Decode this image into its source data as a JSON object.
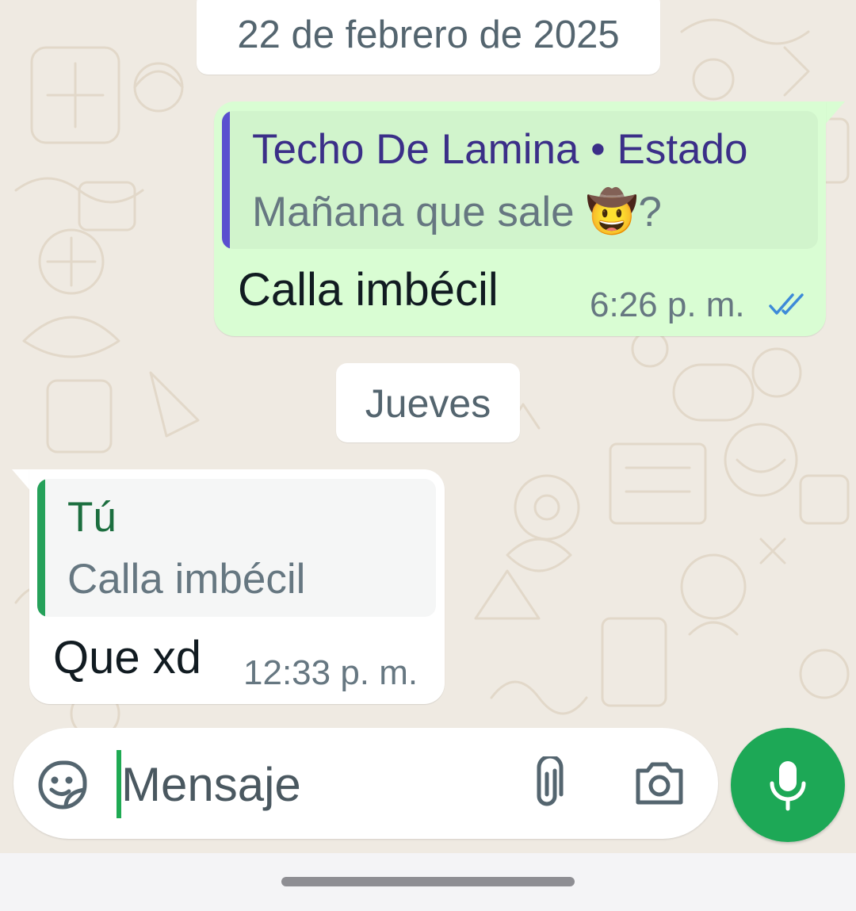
{
  "date_separators": [
    "22 de febrero de 2025",
    "Jueves"
  ],
  "outgoing_message": {
    "reply_to": {
      "author": "Techo De Lamina • Estado",
      "text": "Mañana que sale",
      "emoji": "🤠",
      "suffix": "?"
    },
    "text": "Calla imbécil",
    "time": "6:26 p. m.",
    "status": "read"
  },
  "incoming_message": {
    "reply_to": {
      "author": "Tú",
      "text": "Calla imbécil"
    },
    "text": "Que xd",
    "time": "12:33 p. m."
  },
  "composer": {
    "placeholder": "Mensaje",
    "icons": [
      "sticker-icon",
      "paperclip-icon",
      "camera-icon",
      "microphone-icon"
    ]
  },
  "colors": {
    "chat_background": "#efeae2",
    "outgoing_bubble": "#d9fdd3",
    "incoming_bubble": "#ffffff",
    "read_ticks": "#3d8ad8",
    "mic_button": "#1da856",
    "status_quote_bar": "#5a4fcf",
    "self_quote_bar": "#25a15a"
  }
}
